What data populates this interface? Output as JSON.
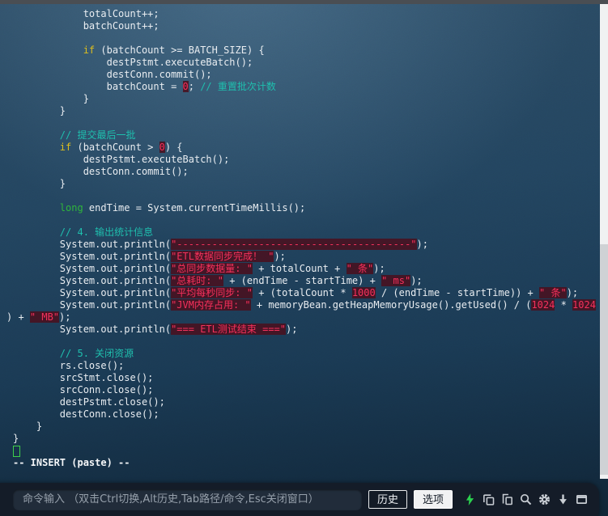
{
  "editor": {
    "mode_text": "-- INSERT (paste) --",
    "colors": {
      "keyword": "#dcbe1e",
      "type_keyword": "#2fb53b",
      "string": "#f0335e",
      "number": "#f0335e",
      "comment": "#1fbfae",
      "default_text": "#e9edf1",
      "cursor": "#3ecf4a",
      "string_background": "#4a0f1d"
    },
    "lines": [
      {
        "segs": [
          [
            "w",
            "            totalCount++;"
          ]
        ]
      },
      {
        "segs": [
          [
            "w",
            "            batchCount++;"
          ]
        ]
      },
      {
        "segs": []
      },
      {
        "segs": [
          [
            "w",
            "            "
          ],
          [
            "k",
            "if"
          ],
          [
            "w",
            " (batchCount >= BATCH_SIZE) {"
          ]
        ]
      },
      {
        "segs": [
          [
            "w",
            "                destPstmt.executeBatch();"
          ]
        ]
      },
      {
        "segs": [
          [
            "w",
            "                destConn.commit();"
          ]
        ]
      },
      {
        "segs": [
          [
            "w",
            "                batchCount = "
          ],
          [
            "n",
            "0"
          ],
          [
            "w",
            "; "
          ],
          [
            "c",
            "// 重置批次计数"
          ]
        ]
      },
      {
        "segs": [
          [
            "w",
            "            }"
          ]
        ]
      },
      {
        "segs": [
          [
            "w",
            "        }"
          ]
        ]
      },
      {
        "segs": []
      },
      {
        "segs": [
          [
            "w",
            "        "
          ],
          [
            "c",
            "// 提交最后一批"
          ]
        ]
      },
      {
        "segs": [
          [
            "w",
            "        "
          ],
          [
            "k",
            "if"
          ],
          [
            "w",
            " (batchCount > "
          ],
          [
            "n",
            "0"
          ],
          [
            "w",
            ") {"
          ]
        ]
      },
      {
        "segs": [
          [
            "w",
            "            destPstmt.executeBatch();"
          ]
        ]
      },
      {
        "segs": [
          [
            "w",
            "            destConn.commit();"
          ]
        ]
      },
      {
        "segs": [
          [
            "w",
            "        }"
          ]
        ]
      },
      {
        "segs": []
      },
      {
        "segs": [
          [
            "w",
            "        "
          ],
          [
            "g",
            "long"
          ],
          [
            "w",
            " endTime = System.currentTimeMillis();"
          ]
        ]
      },
      {
        "segs": []
      },
      {
        "segs": [
          [
            "w",
            "        "
          ],
          [
            "c",
            "// 4. 输出统计信息"
          ]
        ]
      },
      {
        "segs": [
          [
            "w",
            "        System.out.println("
          ],
          [
            "s",
            "\"----------------------------------------\""
          ],
          [
            "w",
            ");"
          ]
        ]
      },
      {
        "segs": [
          [
            "w",
            "        System.out.println("
          ],
          [
            "s",
            "\"ETL数据同步完成！ \""
          ],
          [
            "w",
            ");"
          ]
        ]
      },
      {
        "segs": [
          [
            "w",
            "        System.out.println("
          ],
          [
            "s",
            "\"总同步数据量: \""
          ],
          [
            "w",
            " + totalCount + "
          ],
          [
            "s",
            "\" 条\""
          ],
          [
            "w",
            ");"
          ]
        ]
      },
      {
        "segs": [
          [
            "w",
            "        System.out.println("
          ],
          [
            "s",
            "\"总耗时: \""
          ],
          [
            "w",
            " + (endTime - startTime) + "
          ],
          [
            "s",
            "\" ms\""
          ],
          [
            "w",
            ");"
          ]
        ]
      },
      {
        "segs": [
          [
            "w",
            "        System.out.println("
          ],
          [
            "s",
            "\"平均每秒同步: \""
          ],
          [
            "w",
            " + (totalCount * "
          ],
          [
            "n",
            "1000"
          ],
          [
            "w",
            " / (endTime - startTime)) + "
          ],
          [
            "s",
            "\" 条\""
          ],
          [
            "w",
            ");"
          ]
        ]
      },
      {
        "segs": [
          [
            "w",
            "        System.out.println("
          ],
          [
            "s",
            "\"JVM内存占用: \""
          ],
          [
            "w",
            " + memoryBean.getHeapMemoryUsage().getUsed() / ("
          ],
          [
            "n",
            "1024"
          ],
          [
            "w",
            " * "
          ],
          [
            "n",
            "1024"
          ]
        ]
      },
      {
        "wrap": true,
        "segs": [
          [
            "w",
            ") + "
          ],
          [
            "s",
            "\" MB\""
          ],
          [
            "w",
            ");"
          ]
        ]
      },
      {
        "segs": [
          [
            "w",
            "        System.out.println("
          ],
          [
            "s",
            "\"=== ETL测试结束 ===\""
          ],
          [
            "w",
            ");"
          ]
        ]
      },
      {
        "segs": []
      },
      {
        "segs": [
          [
            "w",
            "        "
          ],
          [
            "c",
            "// 5. 关闭资源"
          ]
        ]
      },
      {
        "segs": [
          [
            "w",
            "        rs.close();"
          ]
        ]
      },
      {
        "segs": [
          [
            "w",
            "        srcStmt.close();"
          ]
        ]
      },
      {
        "segs": [
          [
            "w",
            "        srcConn.close();"
          ]
        ]
      },
      {
        "segs": [
          [
            "w",
            "        destPstmt.close();"
          ]
        ]
      },
      {
        "segs": [
          [
            "w",
            "        destConn.close();"
          ]
        ]
      },
      {
        "segs": [
          [
            "w",
            "    }"
          ]
        ]
      },
      {
        "segs": [
          [
            "w",
            "}"
          ]
        ]
      },
      {
        "cursor": true,
        "segs": []
      },
      {
        "segs": [
          [
            "b",
            "-- INSERT (paste) --"
          ]
        ]
      }
    ]
  },
  "scrollbar": {
    "track_color": "#f0f1f2",
    "thumb_color": "#cfd2d5"
  },
  "bottom_bar": {
    "bar_color": "#141c28",
    "input_color": "#212c3a",
    "icon_color": "#c9ced4",
    "bolt_color": "#2bd14e",
    "input_placeholder": "命令输入 （双击Ctrl切换,Alt历史,Tab路径/命令,Esc关闭窗口）",
    "buttons": [
      {
        "label": "历史",
        "active": false
      },
      {
        "label": "选项",
        "active": true
      }
    ],
    "icons": [
      "lightning-icon",
      "copy-icon",
      "paste-icon",
      "search-icon",
      "gear-icon",
      "download-icon",
      "window-icon"
    ]
  }
}
